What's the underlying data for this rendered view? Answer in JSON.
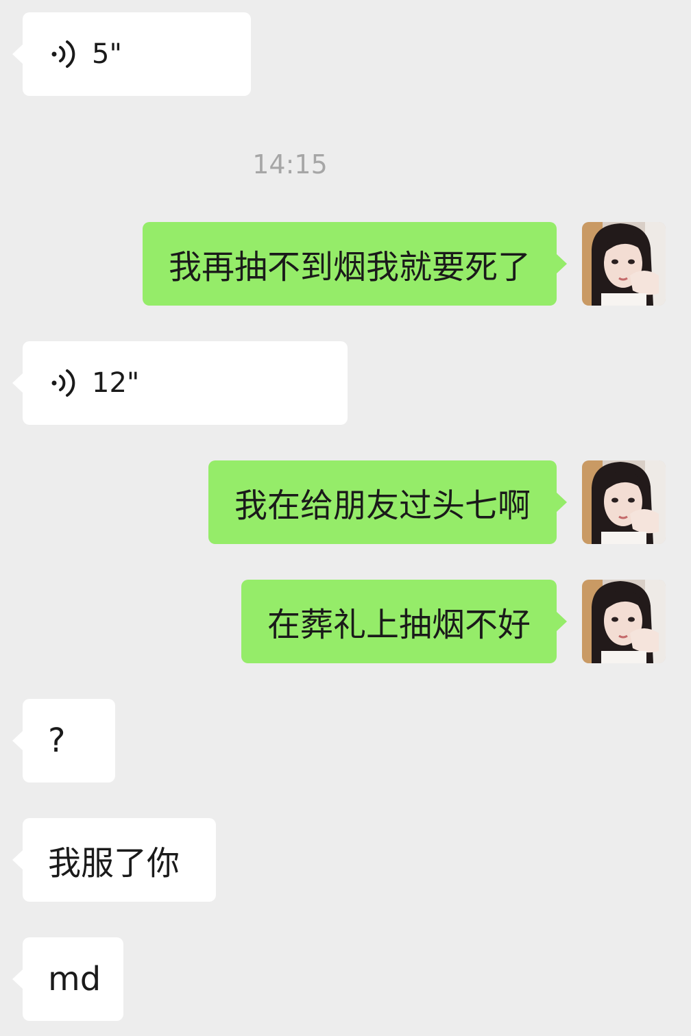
{
  "chat": {
    "timestamp": "14:15",
    "messages": [
      {
        "id": 1,
        "side": "in",
        "type": "voice",
        "duration": "5\""
      },
      {
        "id": 2,
        "side": "out",
        "type": "text",
        "text": "我再抽不到烟我就要死了"
      },
      {
        "id": 3,
        "side": "in",
        "type": "voice",
        "duration": "12\""
      },
      {
        "id": 4,
        "side": "out",
        "type": "text",
        "text": "我在给朋友过头七啊"
      },
      {
        "id": 5,
        "side": "out",
        "type": "text",
        "text": "在葬礼上抽烟不好"
      },
      {
        "id": 6,
        "side": "in",
        "type": "text",
        "text": "?"
      },
      {
        "id": 7,
        "side": "in",
        "type": "text",
        "text": "我服了你"
      },
      {
        "id": 8,
        "side": "in",
        "type": "text",
        "text": "md"
      }
    ]
  },
  "icons": {
    "voice": "voice-wave-icon",
    "avatar": "user-avatar"
  },
  "colors": {
    "background": "#ededed",
    "incoming_bubble": "#ffffff",
    "outgoing_bubble": "#95ec69",
    "timestamp_text": "#a6a6a6"
  }
}
